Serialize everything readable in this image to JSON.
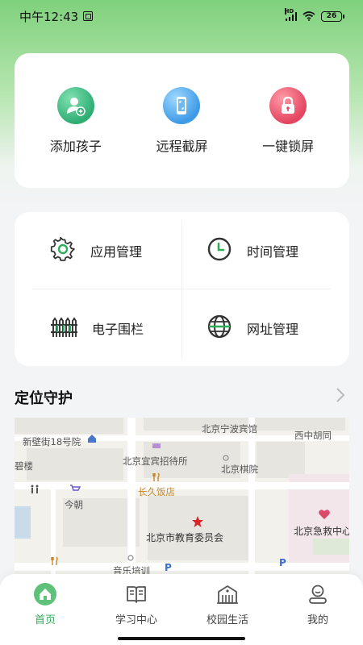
{
  "status": {
    "time": "中午12:43",
    "battery": "26",
    "network": "HD"
  },
  "quick_actions": [
    {
      "label": "添加孩子",
      "icon": "add-child-icon",
      "color": "#2fae74"
    },
    {
      "label": "远程截屏",
      "icon": "phone-screenshot-icon",
      "color": "#3d9ae6"
    },
    {
      "label": "一键锁屏",
      "icon": "lock-icon",
      "color": "#e44560"
    }
  ],
  "manage": [
    {
      "label": "应用管理",
      "icon": "gear-icon"
    },
    {
      "label": "时间管理",
      "icon": "clock-icon"
    },
    {
      "label": "电子围栏",
      "icon": "fence-icon"
    },
    {
      "label": "网址管理",
      "icon": "globe-icon"
    }
  ],
  "location": {
    "title": "定位守护",
    "map_labels": {
      "l1": "新壁街18号院",
      "l2": "北京宁波宾馆",
      "l3": "西中胡同",
      "l4": "北京宜宾招待所",
      "l5": "北京棋院",
      "l6": "长久饭店",
      "l7": "今朝",
      "l8": "北京市教育委员会",
      "l9": "北京急救中心",
      "l10": "音乐培训",
      "l11": "碧楼"
    }
  },
  "tabs": [
    {
      "label": "首页",
      "active": true
    },
    {
      "label": "学习中心",
      "active": false
    },
    {
      "label": "校园生活",
      "active": false
    },
    {
      "label": "我的",
      "active": false
    }
  ],
  "colors": {
    "accent": "#2fae5a",
    "header_green": "#7fd17c"
  }
}
